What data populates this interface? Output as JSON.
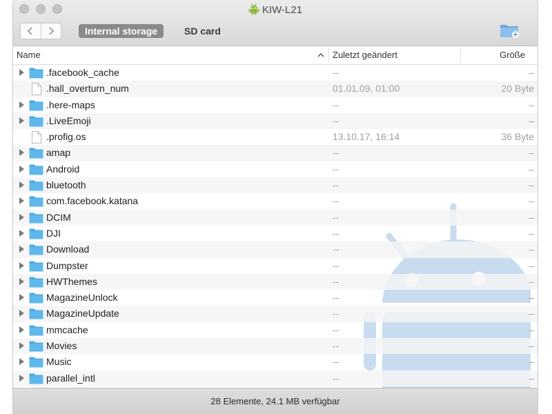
{
  "window": {
    "title": "KIW-L21"
  },
  "toolbar": {
    "tabs": [
      {
        "label": "Internal storage",
        "active": true
      },
      {
        "label": "SD card",
        "active": false
      }
    ]
  },
  "columns": {
    "name": "Name",
    "modified": "Zuletzt geändert",
    "size": "Größe"
  },
  "files": [
    {
      "name": ".facebook_cache",
      "type": "folder",
      "modified": "--",
      "size": "–"
    },
    {
      "name": ".hall_overturn_num",
      "type": "file",
      "modified": "01.01.09, 01:00",
      "size": "20 Byte"
    },
    {
      "name": ".here-maps",
      "type": "folder",
      "modified": "--",
      "size": "–"
    },
    {
      "name": ".LiveEmoji",
      "type": "folder",
      "modified": "--",
      "size": "–"
    },
    {
      "name": ".profig.os",
      "type": "file",
      "modified": "13.10.17, 16:14",
      "size": "36 Byte"
    },
    {
      "name": "amap",
      "type": "folder",
      "modified": "--",
      "size": "–"
    },
    {
      "name": "Android",
      "type": "folder",
      "modified": "--",
      "size": "–"
    },
    {
      "name": "bluetooth",
      "type": "folder",
      "modified": "--",
      "size": "–"
    },
    {
      "name": "com.facebook.katana",
      "type": "folder",
      "modified": "--",
      "size": "–"
    },
    {
      "name": "DCIM",
      "type": "folder",
      "modified": "--",
      "size": "–"
    },
    {
      "name": "DJI",
      "type": "folder",
      "modified": "--",
      "size": "–"
    },
    {
      "name": "Download",
      "type": "folder",
      "modified": "--",
      "size": "–"
    },
    {
      "name": "Dumpster",
      "type": "folder",
      "modified": "--",
      "size": "–"
    },
    {
      "name": "HWThemes",
      "type": "folder",
      "modified": "--",
      "size": "–"
    },
    {
      "name": "MagazineUnlock",
      "type": "folder",
      "modified": "--",
      "size": "–"
    },
    {
      "name": "MagazineUpdate",
      "type": "folder",
      "modified": "--",
      "size": "–"
    },
    {
      "name": "mmcache",
      "type": "folder",
      "modified": "--",
      "size": "–"
    },
    {
      "name": "Movies",
      "type": "folder",
      "modified": "--",
      "size": "–"
    },
    {
      "name": "Music",
      "type": "folder",
      "modified": "--",
      "size": "–"
    },
    {
      "name": "parallel_intl",
      "type": "folder",
      "modified": "--",
      "size": "–"
    }
  ],
  "status": {
    "text": "28 Elemente, 24.1 MB verfügbar"
  },
  "colors": {
    "folder": "#5fb8ec",
    "android_green": "#8fb73e",
    "watermark": "#c9dcef"
  }
}
